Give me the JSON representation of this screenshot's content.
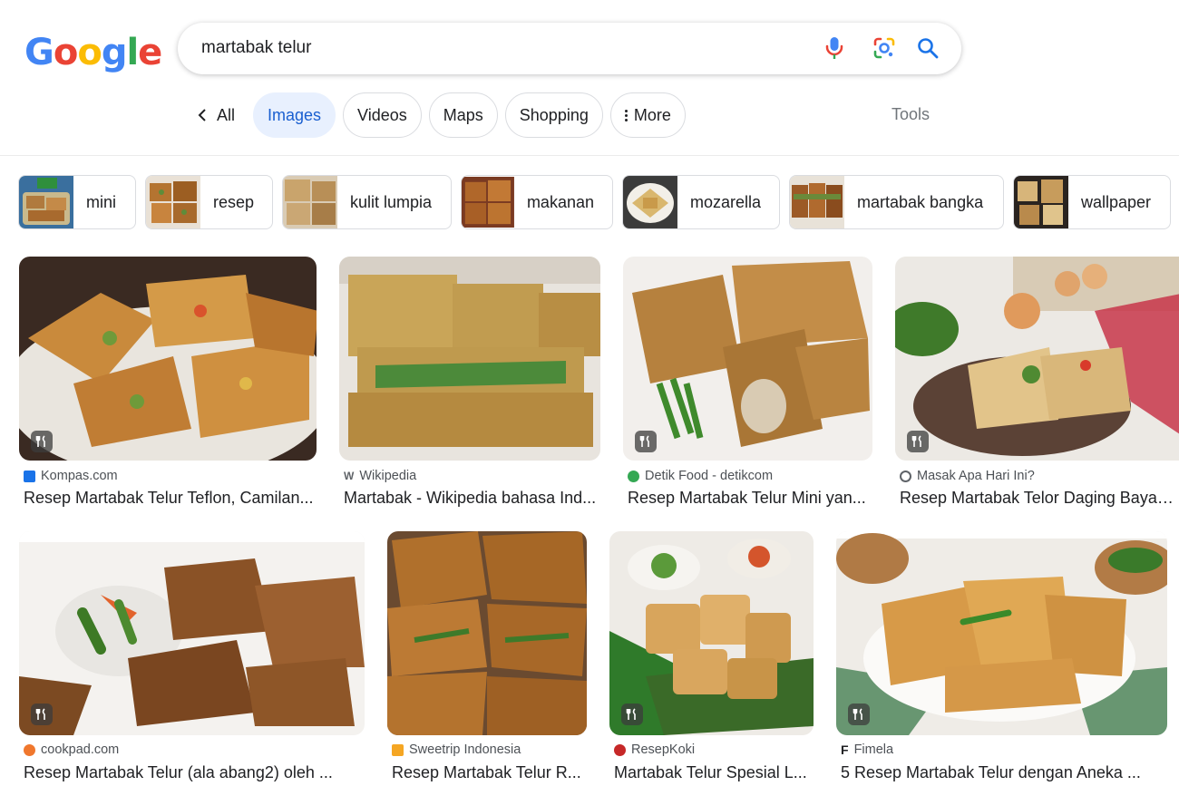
{
  "logo": {
    "letters": [
      "G",
      "o",
      "o",
      "g",
      "l",
      "e"
    ],
    "colors": [
      "#4285f4",
      "#ea4335",
      "#fbbc05",
      "#4285f4",
      "#34a853",
      "#ea4335"
    ]
  },
  "search": {
    "query": "martabak telur",
    "mic_icon": "mic-icon",
    "lens_icon": "google-lens-icon",
    "search_icon": "search-icon"
  },
  "tabs": {
    "back_all": "All",
    "images": "Images",
    "videos": "Videos",
    "maps": "Maps",
    "shopping": "Shopping",
    "more": "More",
    "tools": "Tools"
  },
  "chips": [
    "mini",
    "resep",
    "kulit lumpia",
    "makanan",
    "mozarella",
    "martabak bangka",
    "wallpaper"
  ],
  "results": [
    {
      "source": "Kompas.com",
      "title": "Resep Martabak Telur Teflon, Camilan...",
      "badge_icon": "fork-knife-icon",
      "fav_color": "#1a73e8"
    },
    {
      "source": "Wikipedia",
      "title": "Martabak - Wikipedia bahasa Ind...",
      "badge_icon": "fork-knife-icon",
      "fav_color": "#5f6368"
    },
    {
      "source": "Detik Food - detikcom",
      "title": "Resep Martabak Telur Mini yan...",
      "badge_icon": "fork-knife-icon",
      "fav_color": "#34a853"
    },
    {
      "source": "Masak Apa Hari Ini?",
      "title": "Resep Martabak Telor Daging Bayam ...",
      "badge_icon": "fork-knife-icon",
      "fav_color": "#5f6368"
    },
    {
      "source": "cookpad.com",
      "title": "Resep Martabak Telur (ala abang2) oleh ...",
      "badge_icon": "fork-knife-icon",
      "fav_color": "#f0772d"
    },
    {
      "source": "Sweetrip Indonesia",
      "title": "Resep Martabak Telur R...",
      "badge_icon": "fork-knife-icon",
      "fav_color": "#f5a623"
    },
    {
      "source": "ResepKoki",
      "title": "Martabak Telur Spesial L...",
      "badge_icon": "fork-knife-icon",
      "fav_color": "#c62828"
    },
    {
      "source": "Fimela",
      "title": "5 Resep Martabak Telur dengan Aneka ...",
      "badge_icon": "fork-knife-icon",
      "fav_color": "#202124"
    }
  ]
}
